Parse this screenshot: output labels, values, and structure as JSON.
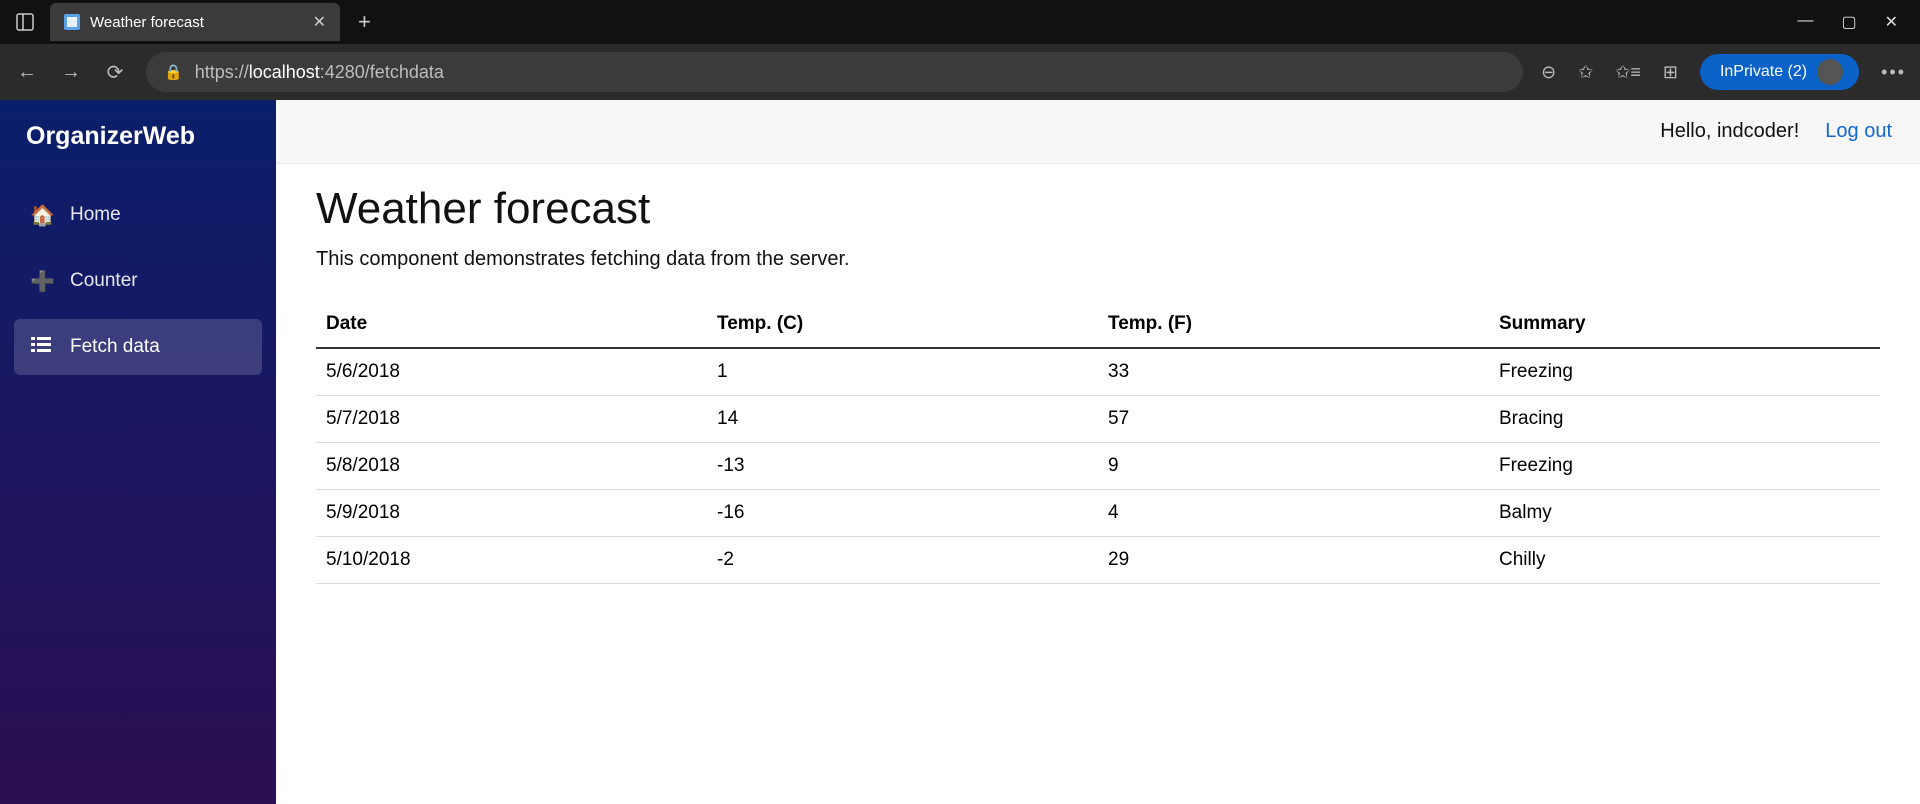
{
  "browser": {
    "tab_title": "Weather forecast",
    "url_prefix": "https://",
    "url_host": "localhost",
    "url_rest": ":4280/fetchdata",
    "inprivate_label": "InPrivate (2)"
  },
  "app": {
    "brand": "OrganizerWeb",
    "nav": {
      "home": "Home",
      "counter": "Counter",
      "fetch": "Fetch data"
    },
    "greeting": "Hello, indcoder!",
    "logout": "Log out"
  },
  "page": {
    "title": "Weather forecast",
    "lead": "This component demonstrates fetching data from the server."
  },
  "table": {
    "headers": {
      "date": "Date",
      "tc": "Temp. (C)",
      "tf": "Temp. (F)",
      "summary": "Summary"
    },
    "rows": [
      {
        "date": "5/6/2018",
        "tc": "1",
        "tf": "33",
        "summary": "Freezing"
      },
      {
        "date": "5/7/2018",
        "tc": "14",
        "tf": "57",
        "summary": "Bracing"
      },
      {
        "date": "5/8/2018",
        "tc": "-13",
        "tf": "9",
        "summary": "Freezing"
      },
      {
        "date": "5/9/2018",
        "tc": "-16",
        "tf": "4",
        "summary": "Balmy"
      },
      {
        "date": "5/10/2018",
        "tc": "-2",
        "tf": "29",
        "summary": "Chilly"
      }
    ]
  }
}
